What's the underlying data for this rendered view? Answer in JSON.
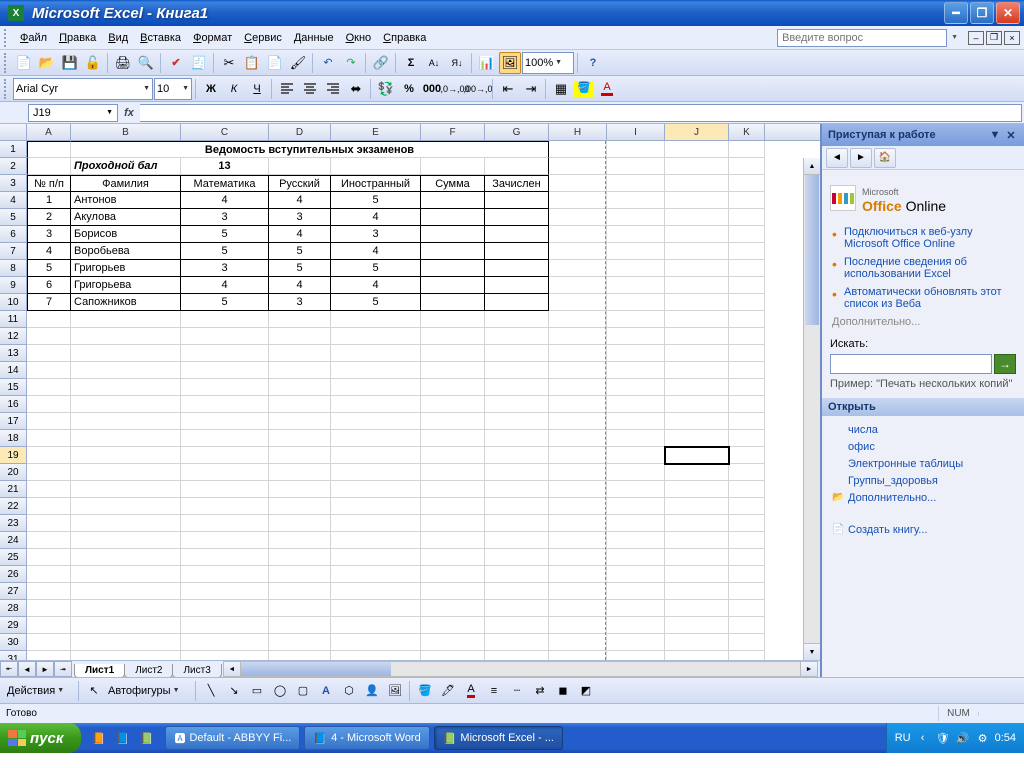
{
  "title": "Microsoft Excel - Книга1",
  "menu": [
    "Файл",
    "Правка",
    "Вид",
    "Вставка",
    "Формат",
    "Сервис",
    "Данные",
    "Окно",
    "Справка"
  ],
  "help_placeholder": "Введите вопрос",
  "formatting": {
    "font": "Arial Cyr",
    "size": "10",
    "zoom": "100%"
  },
  "namebox": "J19",
  "formula": "",
  "active_cell": {
    "row": 19,
    "col": "J"
  },
  "columns": [
    "A",
    "B",
    "C",
    "D",
    "E",
    "F",
    "G",
    "H",
    "I",
    "J",
    "K"
  ],
  "col_widths": {
    "A": 44,
    "B": 110,
    "C": 88,
    "D": 62,
    "E": 90,
    "F": 64,
    "G": 64,
    "H": 58,
    "I": 58,
    "J": 64,
    "K": 36
  },
  "row_count": 31,
  "table": {
    "title": "Ведомость вступительных экзаменов",
    "passing_label": "Проходной бал",
    "passing_score": "13",
    "headers": [
      "№ п/п",
      "Фамилия",
      "Математика",
      "Русский",
      "Иностранный",
      "Сумма",
      "Зачислен"
    ],
    "rows": [
      {
        "n": "1",
        "name": "Антонов",
        "math": "4",
        "rus": "4",
        "for": "5"
      },
      {
        "n": "2",
        "name": "Акулова",
        "math": "3",
        "rus": "3",
        "for": "4"
      },
      {
        "n": "3",
        "name": "Борисов",
        "math": "5",
        "rus": "4",
        "for": "3"
      },
      {
        "n": "4",
        "name": "Воробьева",
        "math": "5",
        "rus": "5",
        "for": "4"
      },
      {
        "n": "5",
        "name": "Григорьев",
        "math": "3",
        "rus": "5",
        "for": "5"
      },
      {
        "n": "6",
        "name": "Григорьева",
        "math": "4",
        "rus": "4",
        "for": "4"
      },
      {
        "n": "7",
        "name": "Сапожников",
        "math": "5",
        "rus": "3",
        "for": "5"
      }
    ]
  },
  "sheets": [
    "Лист1",
    "Лист2",
    "Лист3"
  ],
  "active_sheet": 0,
  "taskpane": {
    "title": "Приступая к работе",
    "office_online": "Office Online",
    "office_prefix": "Microsoft",
    "links1": [
      "Подключиться к веб-узлу Microsoft Office Online",
      "Последние сведения об использовании Excel",
      "Автоматически обновлять этот список из Веба"
    ],
    "more1": "Дополнительно...",
    "search_label": "Искать:",
    "example": "Пример: \"Печать нескольких копий\"",
    "open_section": "Открыть",
    "recent": [
      "числа",
      "офис",
      "Электронные таблицы",
      "Группы_здоровья"
    ],
    "more2": "Дополнительно...",
    "new_book": "Создать книгу..."
  },
  "drawbar": {
    "actions": "Действия",
    "autoshapes": "Автофигуры"
  },
  "status": {
    "ready": "Готово",
    "num": "NUM"
  },
  "taskbar": {
    "start": "пуск",
    "tasks": [
      {
        "icon": "🅰",
        "label": "Default - ABBYY Fi...",
        "active": false
      },
      {
        "icon": "📘",
        "label": "4 - Microsoft Word",
        "active": false
      },
      {
        "icon": "📗",
        "label": "Microsoft Excel - ...",
        "active": true
      }
    ],
    "lang": "RU",
    "time": "0:54"
  }
}
